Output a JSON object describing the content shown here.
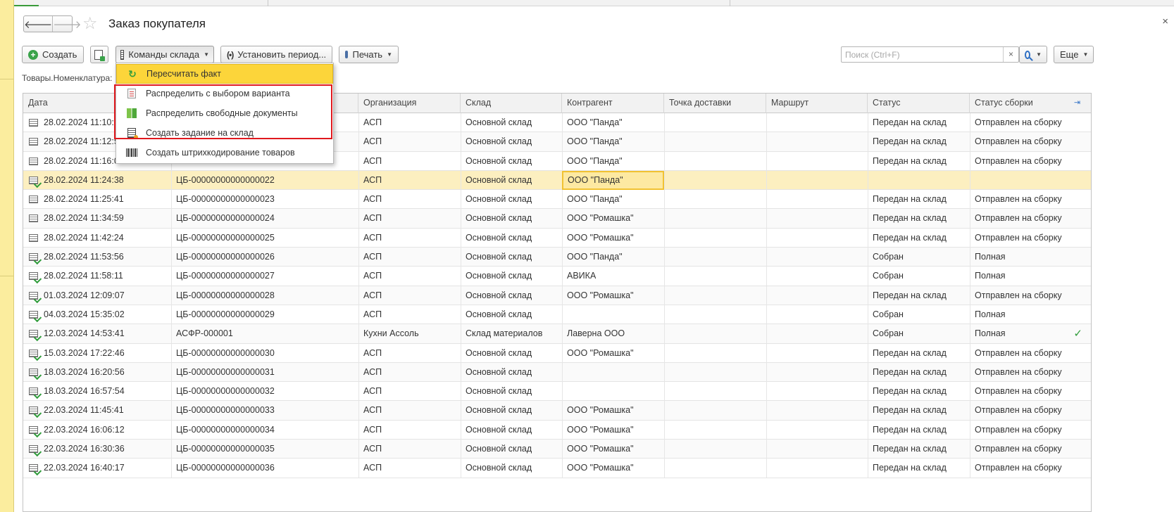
{
  "window": {
    "title": "Заказ покупателя",
    "close_glyph": "×"
  },
  "nav": {
    "back_glyph": "🡐",
    "forward_glyph": "🡒",
    "star_glyph": "☆"
  },
  "toolbar": {
    "create_label": "Создать",
    "warehouse_commands_label": "Команды склада",
    "set_period_label": "Установить период...",
    "print_label": "Печать",
    "more_label": "Еще",
    "search_placeholder": "Поиск (Ctrl+F)",
    "search_clear": "×"
  },
  "filter": {
    "breadcrumb": "Товары.Номенклатура:"
  },
  "menu": {
    "items": [
      {
        "label": "Пересчитать факт",
        "icon": "refresh-icon"
      },
      {
        "label": "Распределить с выбором варианта",
        "icon": "distribute-variant-icon"
      },
      {
        "label": "Распределить свободные документы",
        "icon": "distribute-free-icon"
      },
      {
        "label": "Создать задание на склад",
        "icon": "warehouse-task-icon"
      },
      {
        "label": "Создать штрихкодирование товаров",
        "icon": "barcode-icon"
      }
    ]
  },
  "table": {
    "columns": [
      "Дата",
      "Организация",
      "Склад",
      "Контрагент",
      "Точка доставки",
      "Маршрут",
      "Статус",
      "Статус сборки"
    ],
    "rows": [
      {
        "date": "28.02.2024 11:10:2",
        "number": "",
        "org": "АСП",
        "warehouse": "Основной склад",
        "counterparty": "ООО \"Панда\"",
        "status": "Передан на склад",
        "assembly": "Отправлен на сборку",
        "posted": false
      },
      {
        "date": "28.02.2024 11:12:5",
        "number": "",
        "org": "АСП",
        "warehouse": "Основной склад",
        "counterparty": "ООО \"Панда\"",
        "status": "Передан на склад",
        "assembly": "Отправлен на сборку",
        "posted": false
      },
      {
        "date": "28.02.2024 11:16:0",
        "number": "",
        "org": "АСП",
        "warehouse": "Основной склад",
        "counterparty": "ООО \"Панда\"",
        "status": "Передан на склад",
        "assembly": "Отправлен на сборку",
        "posted": false
      },
      {
        "date": "28.02.2024 11:24:38",
        "number": "ЦБ-00000000000000022",
        "org": "АСП",
        "warehouse": "Основной склад",
        "counterparty": "ООО \"Панда\"",
        "status": "",
        "assembly": "",
        "posted": true
      },
      {
        "date": "28.02.2024 11:25:41",
        "number": "ЦБ-00000000000000023",
        "org": "АСП",
        "warehouse": "Основной склад",
        "counterparty": "ООО \"Панда\"",
        "status": "Передан на склад",
        "assembly": "Отправлен на сборку",
        "posted": false
      },
      {
        "date": "28.02.2024 11:34:59",
        "number": "ЦБ-00000000000000024",
        "org": "АСП",
        "warehouse": "Основной склад",
        "counterparty": "ООО \"Ромашка\"",
        "status": "Передан на склад",
        "assembly": "Отправлен на сборку",
        "posted": false
      },
      {
        "date": "28.02.2024 11:42:24",
        "number": "ЦБ-00000000000000025",
        "org": "АСП",
        "warehouse": "Основной склад",
        "counterparty": "ООО \"Ромашка\"",
        "status": "Передан на склад",
        "assembly": "Отправлен на сборку",
        "posted": false
      },
      {
        "date": "28.02.2024 11:53:56",
        "number": "ЦБ-00000000000000026",
        "org": "АСП",
        "warehouse": "Основной склад",
        "counterparty": "ООО \"Панда\"",
        "status": "Собран",
        "assembly": "Полная",
        "posted": true
      },
      {
        "date": "28.02.2024 11:58:11",
        "number": "ЦБ-00000000000000027",
        "org": "АСП",
        "warehouse": "Основной склад",
        "counterparty": "АВИКА",
        "status": "Собран",
        "assembly": "Полная",
        "posted": true
      },
      {
        "date": "01.03.2024 12:09:07",
        "number": "ЦБ-00000000000000028",
        "org": "АСП",
        "warehouse": "Основной склад",
        "counterparty": "ООО \"Ромашка\"",
        "status": "Передан на склад",
        "assembly": "Отправлен на сборку",
        "posted": true
      },
      {
        "date": "04.03.2024 15:35:02",
        "number": "ЦБ-00000000000000029",
        "org": "АСП",
        "warehouse": "Основной склад",
        "counterparty": "",
        "status": "Собран",
        "assembly": "Полная",
        "posted": true
      },
      {
        "date": "12.03.2024 14:53:41",
        "number": "АСФР-000001",
        "org": "Кухни Ассоль",
        "warehouse": "Склад материалов",
        "counterparty": "Лаверна ООО",
        "status": "Собран",
        "assembly": "Полная",
        "posted": true,
        "check": "✓"
      },
      {
        "date": "15.03.2024 17:22:46",
        "number": "ЦБ-00000000000000030",
        "org": "АСП",
        "warehouse": "Основной склад",
        "counterparty": "ООО \"Ромашка\"",
        "status": "Передан на склад",
        "assembly": "Отправлен на сборку",
        "posted": true
      },
      {
        "date": "18.03.2024 16:20:56",
        "number": "ЦБ-00000000000000031",
        "org": "АСП",
        "warehouse": "Основной склад",
        "counterparty": "",
        "status": "Передан на склад",
        "assembly": "Отправлен на сборку",
        "posted": true
      },
      {
        "date": "18.03.2024 16:57:54",
        "number": "ЦБ-00000000000000032",
        "org": "АСП",
        "warehouse": "Основной склад",
        "counterparty": "",
        "status": "Передан на склад",
        "assembly": "Отправлен на сборку",
        "posted": true
      },
      {
        "date": "22.03.2024 11:45:41",
        "number": "ЦБ-00000000000000033",
        "org": "АСП",
        "warehouse": "Основной склад",
        "counterparty": "ООО \"Ромашка\"",
        "status": "Передан на склад",
        "assembly": "Отправлен на сборку",
        "posted": true
      },
      {
        "date": "22.03.2024 16:06:12",
        "number": "ЦБ-00000000000000034",
        "org": "АСП",
        "warehouse": "Основной склад",
        "counterparty": "ООО \"Ромашка\"",
        "status": "Передан на склад",
        "assembly": "Отправлен на сборку",
        "posted": true
      },
      {
        "date": "22.03.2024 16:30:36",
        "number": "ЦБ-00000000000000035",
        "org": "АСП",
        "warehouse": "Основной склад",
        "counterparty": "ООО \"Ромашка\"",
        "status": "Передан на склад",
        "assembly": "Отправлен на сборку",
        "posted": true
      },
      {
        "date": "22.03.2024 16:40:17",
        "number": "ЦБ-00000000000000036",
        "org": "АСП",
        "warehouse": "Основной склад",
        "counterparty": "ООО \"Ромашка\"",
        "status": "Передан на склад",
        "assembly": "Отправлен на сборку",
        "posted": true
      }
    ],
    "selected_row": 3
  },
  "colors": {
    "accent_yellow": "#fcd53a",
    "highlight_red": "#e0191e",
    "posted_green": "#2f9c3a",
    "selection": "#fcefc0"
  }
}
